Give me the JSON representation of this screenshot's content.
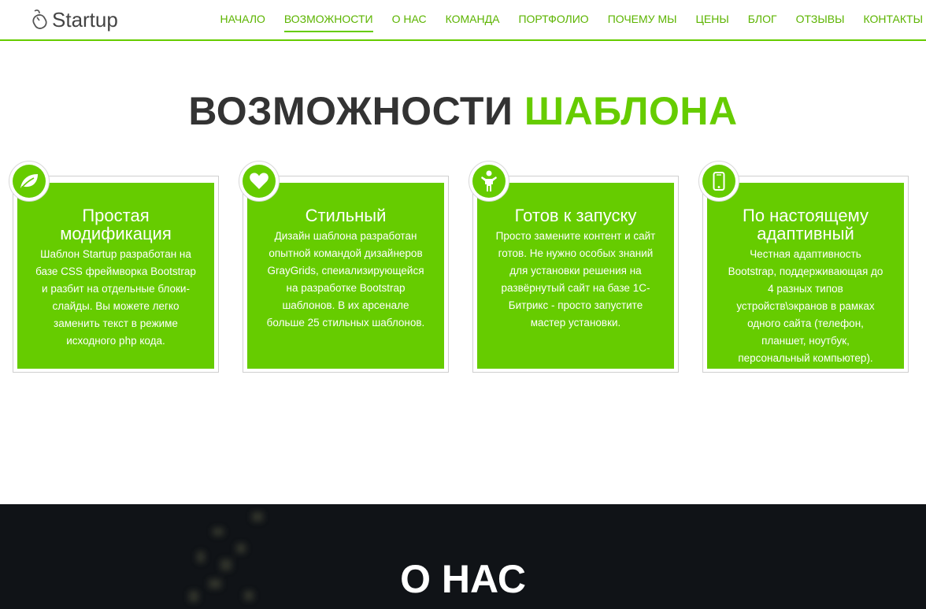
{
  "brand": {
    "logo_text": "Startup",
    "accent_color": "#66cc00"
  },
  "nav": {
    "items": [
      {
        "label": "НАЧАЛО",
        "active": false
      },
      {
        "label": "ВОЗМОЖНОСТИ",
        "active": true
      },
      {
        "label": "О НАС",
        "active": false
      },
      {
        "label": "КОМАНДА",
        "active": false
      },
      {
        "label": "ПОРТФОЛИО",
        "active": false
      },
      {
        "label": "ПОЧЕМУ МЫ",
        "active": false
      },
      {
        "label": "ЦЕНЫ",
        "active": false
      },
      {
        "label": "БЛОГ",
        "active": false
      },
      {
        "label": "ОТЗЫВЫ",
        "active": false
      },
      {
        "label": "КОНТАКТЫ",
        "active": false
      }
    ]
  },
  "features": {
    "title_main": "ВОЗМОЖНОСТИ",
    "title_highlight": "ШАБЛОНА",
    "cards": [
      {
        "icon": "leaf-icon",
        "title": "Простая модификация",
        "text": "Шаблон Startup разработан на базе CSS фреймворка Bootstrap и разбит на отдельные блоки-слайды. Вы можете легко заменить текст в режиме исходного php кода."
      },
      {
        "icon": "heart-icon",
        "title": "Стильный",
        "text": "Дизайн шаблона разработан опытной командой дизайнеров GrayGrids, спеиализирующейся на разработке Bootstrap шаблонов. В их арсенале больше 25 стильных шаблонов."
      },
      {
        "icon": "child-icon",
        "title": "Готов к запуску",
        "text": "Просто замените контент и сайт готов. Не нужно особых знаний для установки решения на развёрнутый сайт на базе 1С-Битрикс - просто запустите мастер установки."
      },
      {
        "icon": "mobile-icon",
        "title": "По настоящему адаптивный",
        "text": "Честная адаптивность Bootstrap, поддерживающая до 4 разных типов устройств\\экранов в рамках одного сайта (телефон, планшет, ноутбук, персональный компьютер)."
      }
    ]
  },
  "about": {
    "title": "О НАС"
  }
}
